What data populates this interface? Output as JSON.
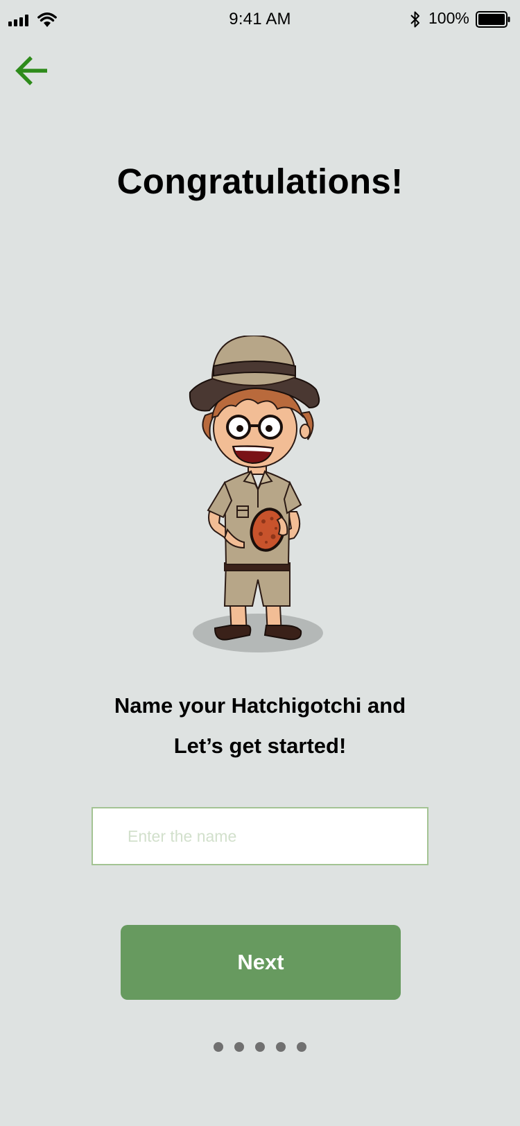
{
  "status_bar": {
    "time": "9:41 AM",
    "battery_percent": "100%",
    "signal_icon": "signal-bars-icon",
    "wifi_icon": "wifi-icon",
    "bluetooth_icon": "bluetooth-icon",
    "battery_icon": "battery-icon",
    "battery_level": 1.0
  },
  "nav": {
    "back_icon": "arrow-left-icon",
    "accent_color": "#2e8b1b"
  },
  "title": "Congratulations!",
  "illustration": "explorer-character-holding-egg",
  "prompt": {
    "line1": "Name your Hatchigotchi and",
    "line2": "Let’s get started!"
  },
  "name_input": {
    "placeholder": "Enter the name",
    "value": ""
  },
  "next_button": {
    "label": "Next",
    "color": "#679a5f"
  },
  "pagination": {
    "count": 5
  },
  "colors": {
    "background": "#dee2e1",
    "input_border": "#a3c393",
    "dot": "#707070"
  }
}
